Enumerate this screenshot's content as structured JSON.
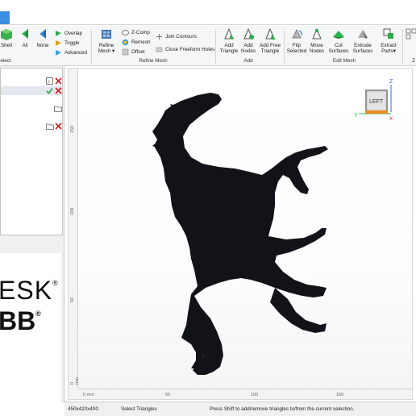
{
  "ribbon": {
    "select_group": {
      "label": "elect",
      "buttons": [
        {
          "label": "Shell",
          "icon": "shell-cube-icon"
        },
        {
          "label": "All",
          "icon": "select-all-icon"
        },
        {
          "label": "None",
          "icon": "select-none-icon"
        }
      ],
      "small": [
        {
          "label": "Overlap",
          "icon": "overlap-icon"
        },
        {
          "label": "Toggle",
          "icon": "toggle-icon"
        },
        {
          "label": "Advanced",
          "icon": "advanced-icon"
        }
      ]
    },
    "refine_group": {
      "label": "Refine Mesh",
      "refine_button": {
        "line1": "Refine",
        "line2": "Mesh ▾"
      },
      "small": [
        {
          "label": "Z-Comp"
        },
        {
          "label": "Remesh"
        },
        {
          "label": "Offset"
        }
      ],
      "join_contours": "Join Contours",
      "close_freeform_holes": "Close Freeform Holes"
    },
    "add_group": {
      "label": "Add",
      "buttons": [
        {
          "line1": "Add",
          "line2": "Triangle"
        },
        {
          "line1": "Add",
          "line2": "Nodes"
        },
        {
          "line1": "Add Free",
          "line2": "Triangle"
        }
      ]
    },
    "edit_group": {
      "label": "Edit Mesh",
      "buttons": [
        {
          "line1": "Flip",
          "line2": "Selected"
        },
        {
          "line1": "Move",
          "line2": "Nodes"
        },
        {
          "line1": "Cut",
          "line2": "Surfaces"
        },
        {
          "line1": "Extrude",
          "line2": "Surfaces"
        },
        {
          "line1": "Extract",
          "line2": "Parts▾"
        }
      ]
    },
    "cut_off_label": "Z"
  },
  "viewcube": {
    "face": "LEFT",
    "axis_z": "Z",
    "axis_y": "Y",
    "axis_x": "X"
  },
  "ruler_vertical": [
    "150",
    "100",
    "50",
    "0 mm"
  ],
  "ruler_horizontal": [
    "0 mm",
    "50",
    "100",
    "150"
  ],
  "logo": {
    "line1": "ESK",
    "line2": "BB",
    "reg": "®"
  },
  "status": {
    "dimensions": "450x420x400",
    "mode": "Select Triangles",
    "hint": "Press Shift to add/remove triangles to/from the current selection."
  },
  "colors": {
    "accent": "#3c8fe0",
    "model": "#111318",
    "ok": "#2ea043",
    "remove": "#d11a1a"
  }
}
